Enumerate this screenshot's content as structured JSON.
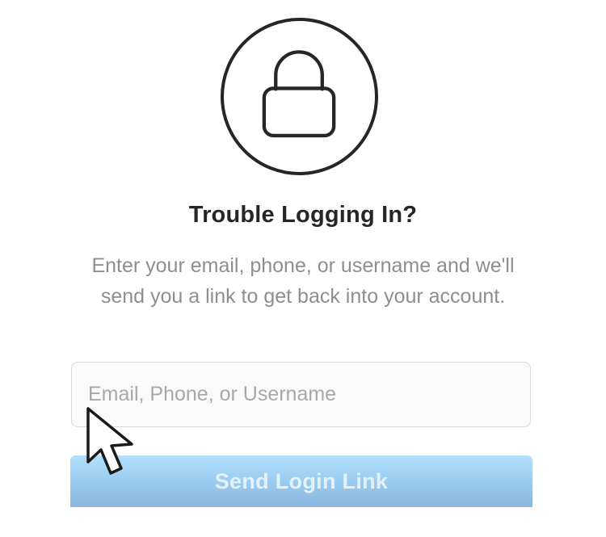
{
  "icon": "lock-icon",
  "title": "Trouble Logging In?",
  "description": "Enter your email, phone, or username and we'll send you a link to get back into your account.",
  "input": {
    "placeholder": "Email, Phone, or Username",
    "value": ""
  },
  "send_button_label": "Send Login Link",
  "colors": {
    "text_primary": "#262626",
    "text_secondary": "#8e8e8e",
    "button_disabled": "#9ccef2",
    "input_border": "#dbdbdb"
  }
}
